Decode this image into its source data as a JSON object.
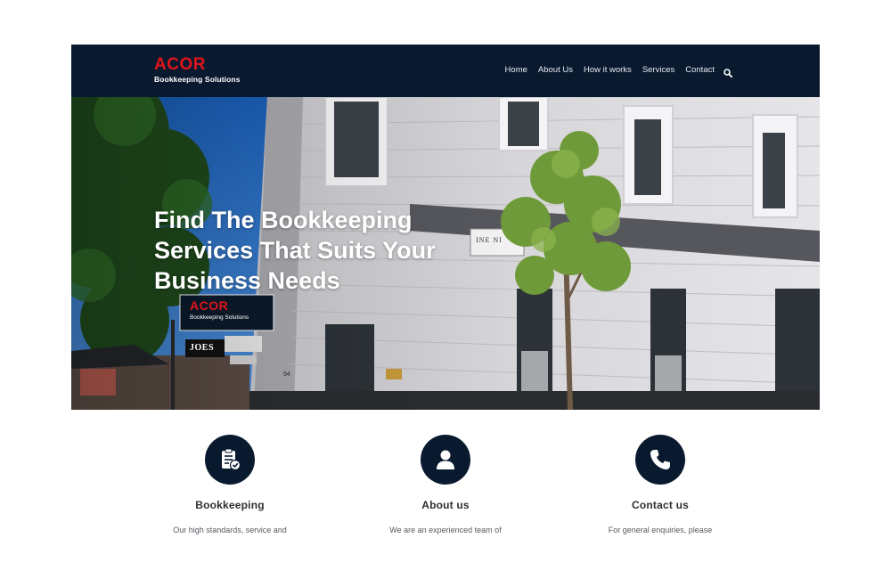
{
  "header": {
    "logo_main": "ACOR",
    "logo_sub": "Bookkeeping Solutions",
    "nav": [
      "Home",
      "About Us",
      "How it works",
      "Services",
      "Contact"
    ]
  },
  "hero": {
    "title": "Find The Bookkeeping Services That Suits Your Business Needs",
    "sign_main": "ACOR",
    "sign_sub": "Bookkeeping Solutions",
    "sign_joes": "JOES",
    "building_sign": "INE NI",
    "street_number": "94"
  },
  "features": [
    {
      "icon": "clipboard-check-icon",
      "title": "Bookkeeping",
      "text": "Our high standards, service and"
    },
    {
      "icon": "user-icon",
      "title": "About us",
      "text": "We are an experienced team of"
    },
    {
      "icon": "phone-icon",
      "title": "Contact us",
      "text": "For general enquiries, please"
    }
  ],
  "colors": {
    "header_bg": "#091a2f",
    "brand_red": "#e0141b",
    "icon_circle": "#091a2f"
  }
}
